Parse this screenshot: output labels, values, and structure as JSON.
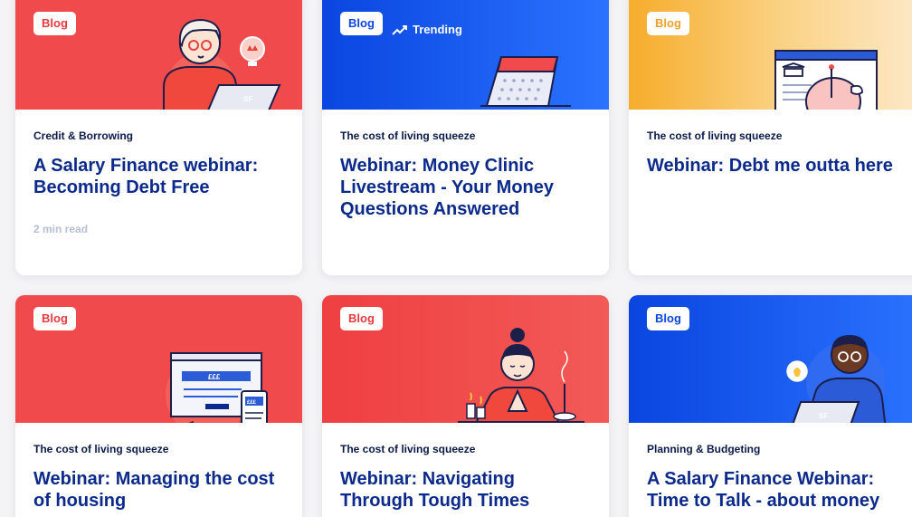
{
  "cards": [
    {
      "badge": "Blog",
      "category": "Credit & Borrowing",
      "title": "A Salary Finance webinar: Becoming Debt Free",
      "read_time": "2 min read",
      "theme": "red",
      "illustration": "woman-laptop"
    },
    {
      "badge": "Blog",
      "trending": "Trending",
      "category": "The cost of living squeeze",
      "title": "Webinar: Money Clinic Livestream - Your Money Questions Answered",
      "theme": "blue",
      "illustration": "calendar"
    },
    {
      "badge": "Blog",
      "category": "The cost of living squeeze",
      "title": "Webinar: Debt me outta here",
      "theme": "yellow",
      "illustration": "piggy-bank"
    },
    {
      "badge": "Blog",
      "category": "The cost of living squeeze",
      "title": "Webinar: Managing the cost of housing",
      "theme": "red",
      "illustration": "browser-phone"
    },
    {
      "badge": "Blog",
      "category": "The cost of living squeeze",
      "title": "Webinar: Navigating Through Tough Times",
      "theme": "red",
      "illustration": "meditation"
    },
    {
      "badge": "Blog",
      "category": "Planning & Budgeting",
      "title": "A Salary Finance Webinar: Time to Talk - about money",
      "theme": "blue",
      "illustration": "man-laptop"
    }
  ],
  "illustration_text": {
    "laptop_logo": "SF",
    "browser_price": "£££",
    "phone_price": "£££"
  },
  "colors": {
    "red": "#f04a4c",
    "blue": "#0a45e0",
    "yellow": "#f6ad2b",
    "title_navy": "#0b2a8c"
  }
}
